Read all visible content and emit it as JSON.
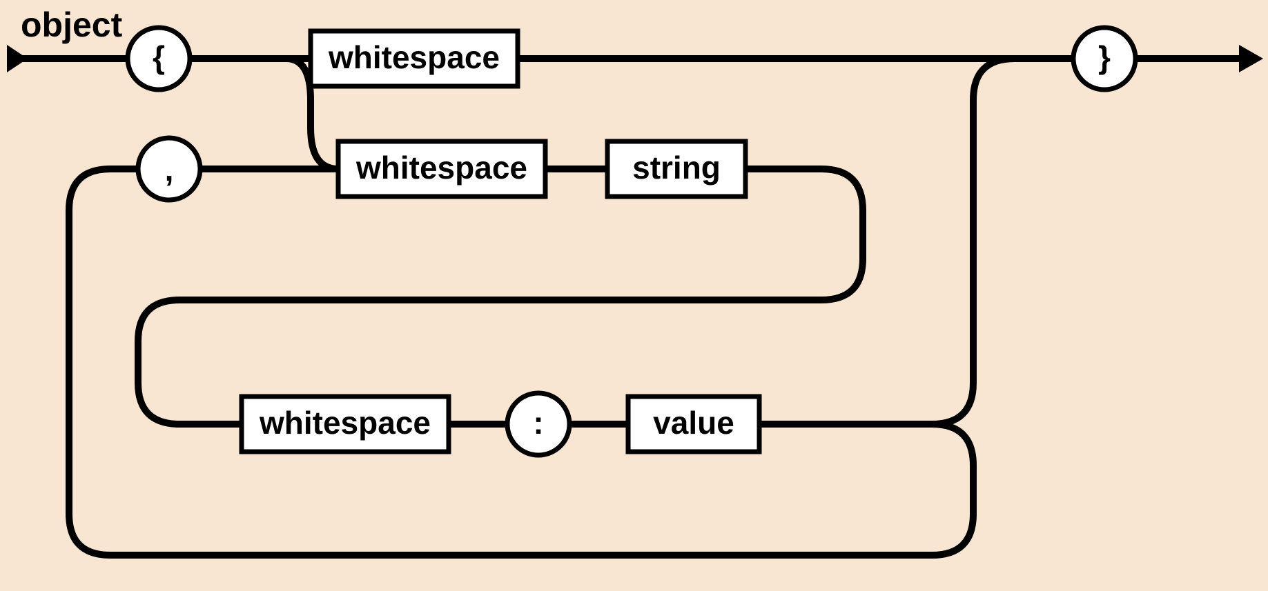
{
  "diagram": {
    "title": "object",
    "terminals": {
      "open_brace": "{",
      "close_brace": "}",
      "comma": ",",
      "colon": ":"
    },
    "nonterminals": {
      "whitespace1": "whitespace",
      "whitespace2": "whitespace",
      "whitespace3": "whitespace",
      "string": "string",
      "value": "value"
    }
  }
}
